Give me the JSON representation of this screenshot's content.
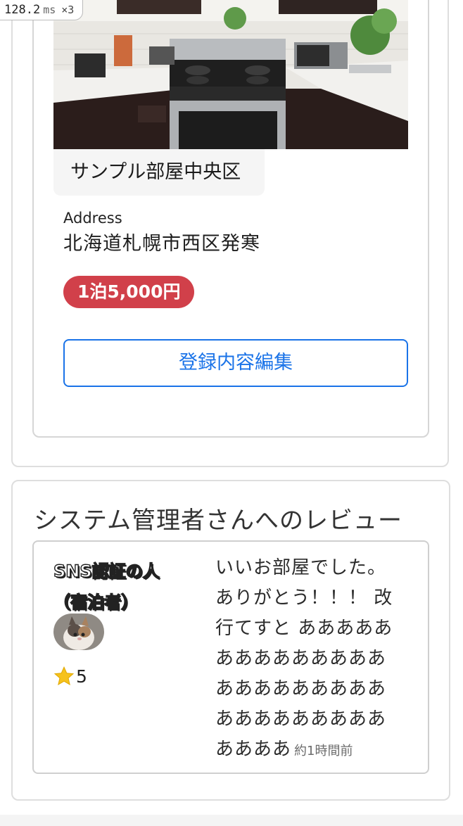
{
  "perf_overlay": {
    "value": "128.2",
    "unit": "ms",
    "multiplier": "×3"
  },
  "room": {
    "name": "サンプル部屋中央区",
    "address_label": "Address",
    "address_value": "北海道札幌市西区発寒",
    "price": "1泊5,000円",
    "edit_label": "登録内容編集"
  },
  "reviews": {
    "title": "システム管理者さんへのレビュー",
    "items": [
      {
        "reviewer": "SNS認証の人（宿泊者）",
        "rating": "5",
        "text": "いいお部屋でした。ありがとう！！！ 改行てすと ああああああああああああああああああああああああああああああああああああ",
        "time": "約1時間前"
      }
    ]
  },
  "colors": {
    "accent": "#1a73e8",
    "price_badge": "#d1404a",
    "star": "#f6c21c"
  }
}
